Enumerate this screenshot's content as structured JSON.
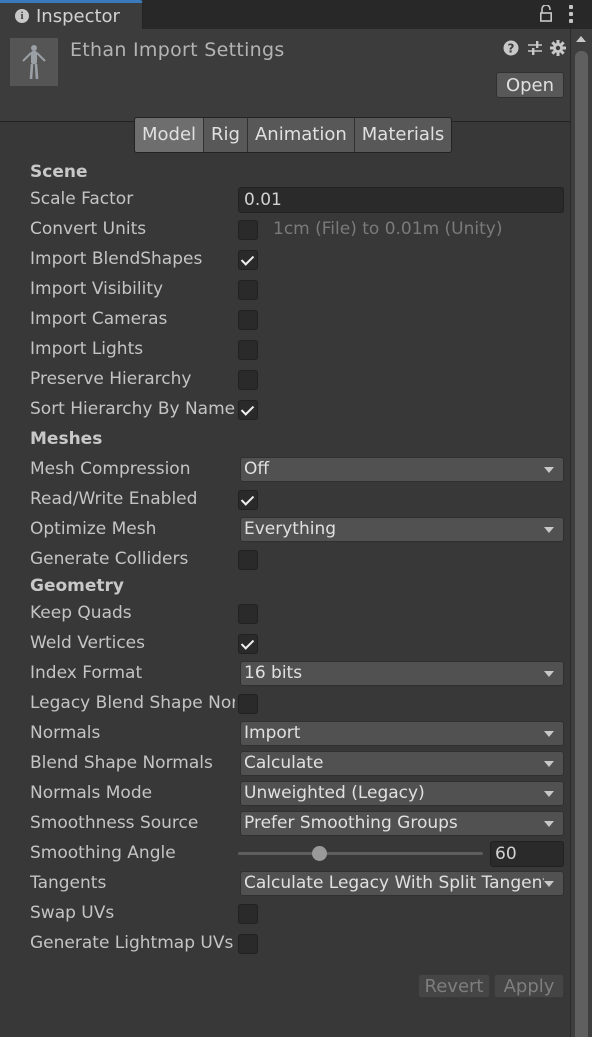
{
  "window": {
    "tab_label": "Inspector",
    "tab_icon": "info-icon",
    "lock_icon": "lock-icon",
    "menu_icon": "kebab-menu-icon"
  },
  "header": {
    "title": "Ethan Import Settings",
    "thumbnail": "humanoid-model-thumbnail",
    "icons": [
      "help-icon",
      "presets-icon",
      "settings-gear-icon"
    ],
    "open_button": "Open"
  },
  "tabs": [
    {
      "label": "Model",
      "active": true
    },
    {
      "label": "Rig",
      "active": false
    },
    {
      "label": "Animation",
      "active": false
    },
    {
      "label": "Materials",
      "active": false
    }
  ],
  "sections": {
    "scene": "Scene",
    "meshes": "Meshes",
    "geometry": "Geometry"
  },
  "fields": {
    "scale_factor": {
      "label": "Scale Factor",
      "value": "0.01"
    },
    "convert_units": {
      "label": "Convert Units",
      "checked": false,
      "hint": "1cm (File) to 0.01m (Unity)"
    },
    "import_blendshapes": {
      "label": "Import BlendShapes",
      "checked": true
    },
    "import_visibility": {
      "label": "Import Visibility",
      "checked": false
    },
    "import_cameras": {
      "label": "Import Cameras",
      "checked": false
    },
    "import_lights": {
      "label": "Import Lights",
      "checked": false
    },
    "preserve_hierarchy": {
      "label": "Preserve Hierarchy",
      "checked": false
    },
    "sort_hierarchy": {
      "label": "Sort Hierarchy By Name",
      "checked": true
    },
    "mesh_compression": {
      "label": "Mesh Compression",
      "value": "Off"
    },
    "read_write": {
      "label": "Read/Write Enabled",
      "checked": true
    },
    "optimize_mesh": {
      "label": "Optimize Mesh",
      "value": "Everything"
    },
    "generate_colliders": {
      "label": "Generate Colliders",
      "checked": false
    },
    "keep_quads": {
      "label": "Keep Quads",
      "checked": false
    },
    "weld_vertices": {
      "label": "Weld Vertices",
      "checked": true
    },
    "index_format": {
      "label": "Index Format",
      "value": "16 bits"
    },
    "legacy_blend_shape_normals": {
      "label": "Legacy Blend Shape Normals",
      "checked": false
    },
    "normals": {
      "label": "Normals",
      "value": "Import"
    },
    "blend_shape_normals": {
      "label": "Blend Shape Normals",
      "value": "Calculate"
    },
    "normals_mode": {
      "label": "Normals Mode",
      "value": "Unweighted (Legacy)"
    },
    "smoothness_source": {
      "label": "Smoothness Source",
      "value": "Prefer Smoothing Groups"
    },
    "smoothing_angle": {
      "label": "Smoothing Angle",
      "value": "60",
      "min": 0,
      "max": 180
    },
    "tangents": {
      "label": "Tangents",
      "value": "Calculate Legacy With Split Tangents"
    },
    "swap_uvs": {
      "label": "Swap UVs",
      "checked": false
    },
    "generate_lightmap_uvs": {
      "label": "Generate Lightmap UVs",
      "checked": false
    }
  },
  "footer": {
    "revert": "Revert",
    "apply": "Apply"
  }
}
